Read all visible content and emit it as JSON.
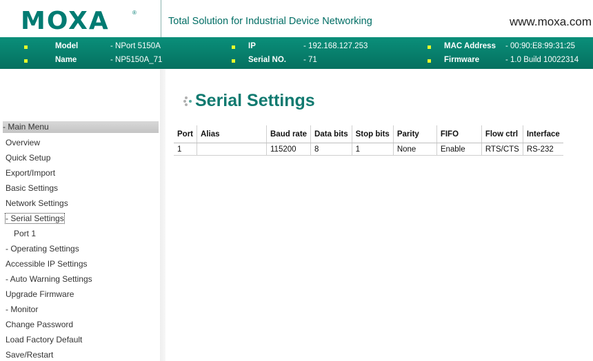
{
  "header": {
    "logo": "MOXA",
    "logo_mark": "®",
    "tagline": "Total Solution for Industrial Device Networking",
    "url": "www.moxa.com"
  },
  "info": {
    "model_label": "Model",
    "model_value": "- NPort 5150A",
    "name_label": "Name",
    "name_value": "- NP5150A_71",
    "ip_label": "IP",
    "ip_value": "- 192.168.127.253",
    "serial_label": "Serial NO.",
    "serial_value": "- 71",
    "mac_label": "MAC Address",
    "mac_value": "- 00:90:E8:99:31:25",
    "firmware_label": "Firmware",
    "firmware_value": "- 1.0 Build 10022314",
    "bullet_color": "#e7ff2a",
    "bar_color": "#0a8f7a"
  },
  "sidebar": {
    "header": "- Main Menu",
    "items": [
      "Overview",
      "Quick Setup",
      "Export/Import",
      "Basic Settings",
      "Network Settings",
      "- Serial Settings",
      "Port 1",
      "- Operating Settings",
      "Accessible IP Settings",
      "- Auto Warning Settings",
      "Upgrade Firmware",
      "- Monitor",
      "Change Password",
      "Load Factory Default",
      "Save/Restart"
    ]
  },
  "main": {
    "title": "Serial Settings",
    "title_color": "#117a70",
    "table": {
      "headers": [
        "Port",
        "Alias",
        "Baud rate",
        "Data bits",
        "Stop bits",
        "Parity",
        "FIFO",
        "Flow ctrl",
        "Interface"
      ],
      "rows": [
        [
          "1",
          "",
          "115200",
          "8",
          "1",
          "None",
          "Enable",
          "RTS/CTS",
          "RS-232"
        ]
      ]
    }
  }
}
